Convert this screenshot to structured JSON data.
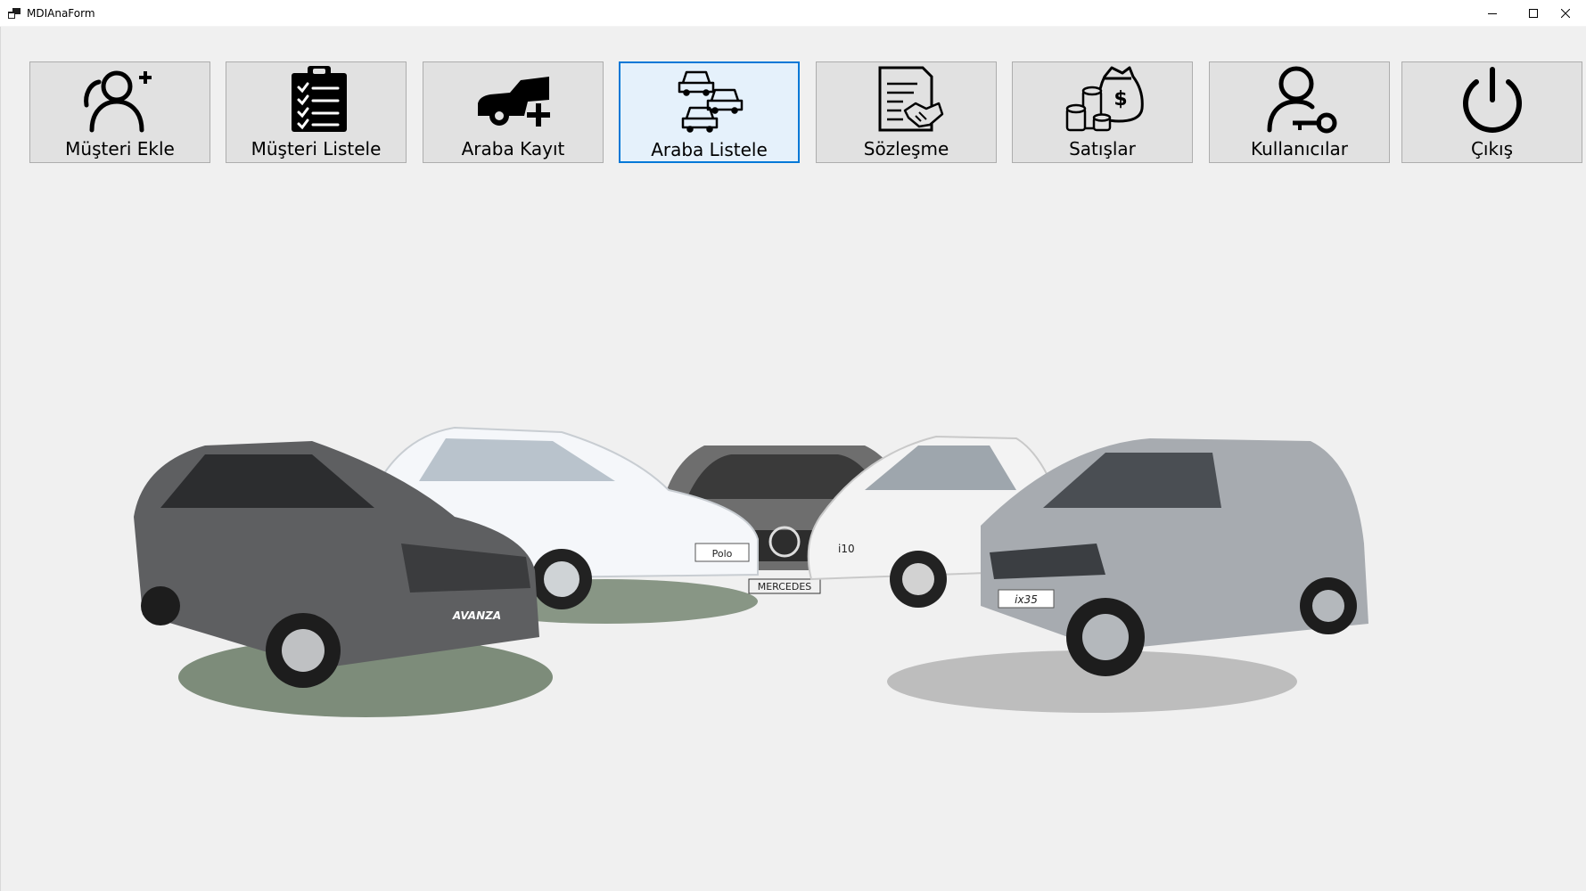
{
  "window": {
    "title": "MDIAnaForm"
  },
  "toolbar": {
    "buttons": [
      {
        "label": "Müşteri Ekle",
        "icon": "add-user-icon"
      },
      {
        "label": "Müşteri Listele",
        "icon": "clipboard-list-icon"
      },
      {
        "label": "Araba Kayıt",
        "icon": "car-add-icon"
      },
      {
        "label": "Araba Listele",
        "icon": "cars-list-icon",
        "active": true
      },
      {
        "label": "Sözleşme",
        "icon": "contract-handshake-icon"
      },
      {
        "label": "Satışlar",
        "icon": "money-bag-icon"
      },
      {
        "label": "Kullanıcılar",
        "icon": "user-key-icon"
      },
      {
        "label": "Çıkış",
        "icon": "power-icon"
      }
    ]
  },
  "colors": {
    "accent": "#0078d7",
    "button_face": "#e1e1e1",
    "background": "#f0f0f0"
  },
  "background_image": {
    "labels": [
      "AVANZA",
      "Polo",
      "MERCEDES",
      "i10",
      "ix35"
    ]
  }
}
